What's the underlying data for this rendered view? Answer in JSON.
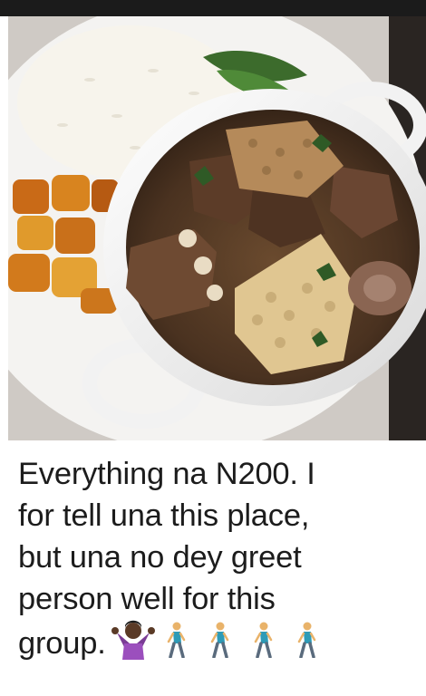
{
  "caption": {
    "lines": [
      "Everything na N200. I",
      "for tell una this place,",
      "but una no dey greet",
      "person well for this",
      "group."
    ]
  },
  "icons": {
    "shrug": "person-shrugging-emoji",
    "walk": "person-walking-emoji"
  },
  "colors": {
    "background": "#ffffff",
    "text": "#1c1c1c"
  }
}
